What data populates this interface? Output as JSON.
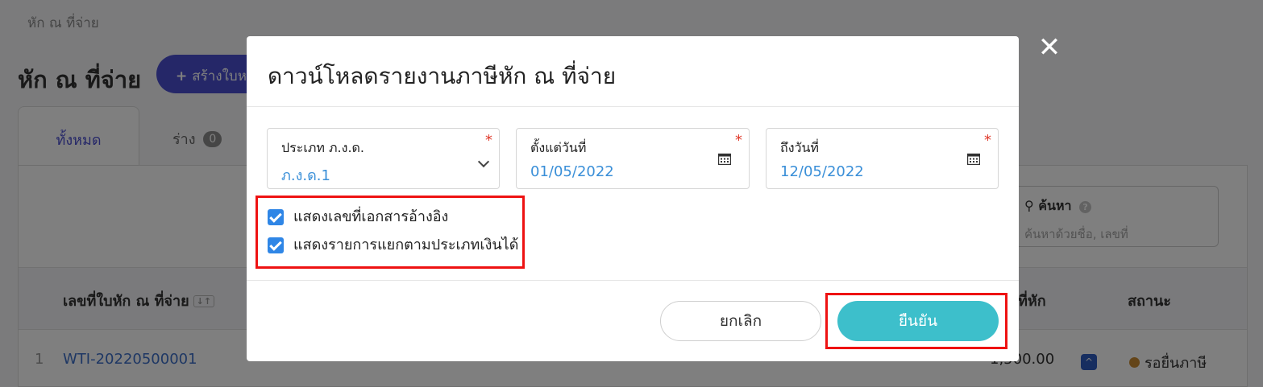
{
  "background": {
    "breadcrumb": "หัก ณ ที่จ่าย",
    "page_title": "หัก ณ ที่จ่าย",
    "create_button": "สร้างใบห",
    "tabs": [
      {
        "label": "ทั้งหมด"
      },
      {
        "label": "ร่าง",
        "count": "0"
      }
    ],
    "search": {
      "label": "ค้นหา",
      "placeholder": "ค้นหาด้วยชื่อ, เลขที่"
    },
    "table": {
      "headers": {
        "doc_number": "เลขที่ใบหัก ณ ที่จ่าย",
        "withheld": "ที่หัก",
        "status": "สถานะ"
      },
      "rows": [
        {
          "index": "1",
          "doc_number": "WTI-20220500001",
          "withheld_amount": "1,500.00",
          "status": "รอยื่นภาษี"
        }
      ]
    }
  },
  "modal": {
    "title": "ดาวน์โหลดรายงานภาษีหัก ณ ที่จ่าย",
    "close_symbol": "✕",
    "fields": {
      "type": {
        "label": "ประเภท ภ.ง.ด.",
        "value": "ภ.ง.ด.1",
        "required_mark": "*"
      },
      "from": {
        "label": "ตั้งแต่วันที่",
        "value": "01/05/2022",
        "required_mark": "*"
      },
      "to": {
        "label": "ถึงวันที่",
        "value": "12/05/2022",
        "required_mark": "*"
      }
    },
    "checkboxes": [
      {
        "label": "แสดงเลขที่เอกสารอ้างอิง",
        "checked": true
      },
      {
        "label": "แสดงรายการแยกตามประเภทเงินได้",
        "checked": true
      }
    ],
    "cancel_label": "ยกเลิก",
    "confirm_label": "ยืนยัน"
  },
  "colors": {
    "primary": "#4a4fd1",
    "confirm": "#3dbfcb",
    "checkbox": "#2f86e6",
    "highlight": "#ee1212",
    "link": "#3d6fc9"
  }
}
